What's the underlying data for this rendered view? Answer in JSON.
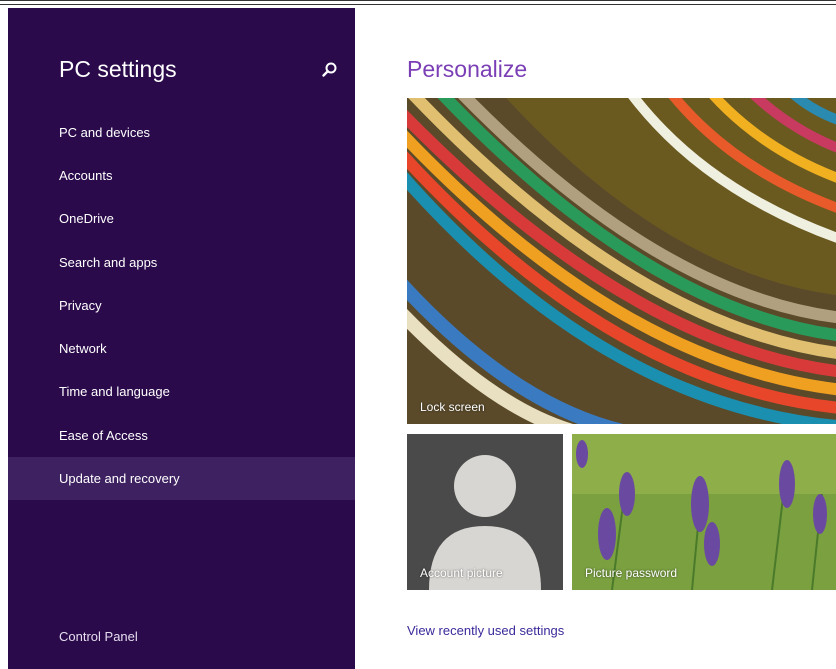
{
  "sidebar": {
    "title": "PC settings",
    "search_icon": "search-icon",
    "items": [
      {
        "label": "PC and devices"
      },
      {
        "label": "Accounts"
      },
      {
        "label": "OneDrive"
      },
      {
        "label": "Search and apps"
      },
      {
        "label": "Privacy"
      },
      {
        "label": "Network"
      },
      {
        "label": "Time and language"
      },
      {
        "label": "Ease of Access"
      },
      {
        "label": "Update and recovery",
        "selected": true
      }
    ],
    "footer_link": "Control Panel"
  },
  "main": {
    "heading": "Personalize",
    "tiles": {
      "lock_screen": "Lock screen",
      "account_picture": "Account picture",
      "picture_password": "Picture password"
    },
    "recent_link": "View recently used settings"
  },
  "colors": {
    "sidebar_bg": "#2a0a4a",
    "selected_bg": "#3d2160",
    "heading_accent": "#7b3fb5",
    "link": "#3a2a9a"
  }
}
